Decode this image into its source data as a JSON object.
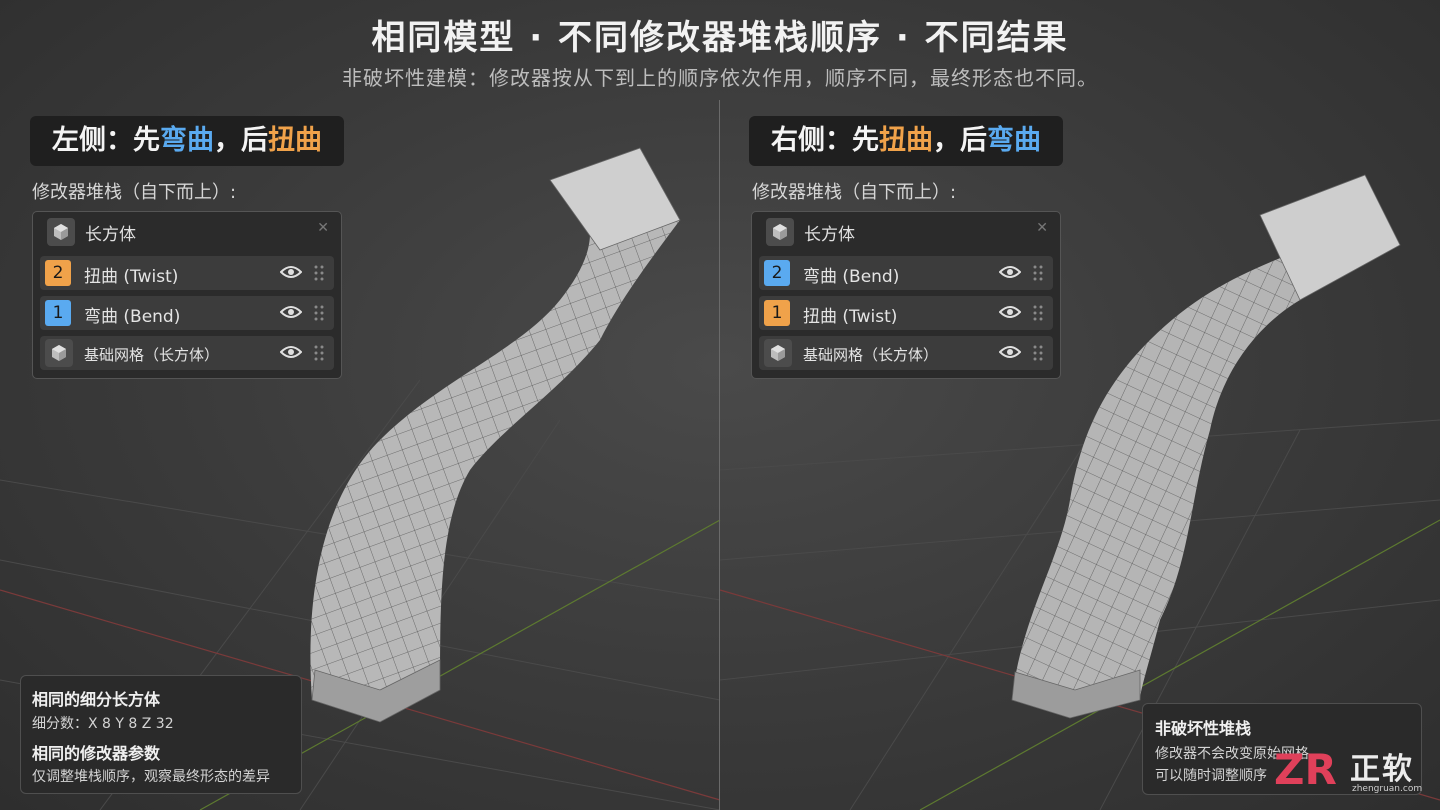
{
  "header": {
    "title": "相同模型 · 不同修改器堆栈顺序 · 不同结果",
    "subtitle": "非破坏性建模：修改器按从下到上的顺序依次作用，顺序不同，最终形态也不同。"
  },
  "left": {
    "title_parts": [
      "左侧：先",
      "弯曲",
      "，后",
      "扭曲"
    ],
    "stack_caption": "修改器堆栈（自下而上）:",
    "object_name": "长方体",
    "modifiers": [
      {
        "index": "2",
        "label": "扭曲 (Twist)",
        "color": "#f0a24a"
      },
      {
        "index": "1",
        "label": "弯曲 (Bend)",
        "color": "#5aaaf0"
      }
    ],
    "base_mesh": "基础网格（长方体）"
  },
  "right": {
    "title_parts": [
      "右侧：先",
      "扭曲",
      "，后",
      "弯曲"
    ],
    "stack_caption": "修改器堆栈（自下而上）:",
    "object_name": "长方体",
    "modifiers": [
      {
        "index": "2",
        "label": "弯曲 (Bend)",
        "color": "#5aaaf0"
      },
      {
        "index": "1",
        "label": "扭曲 (Twist)",
        "color": "#f0a24a"
      }
    ],
    "base_mesh": "基础网格（长方体）"
  },
  "info_left": {
    "heading1": "相同的细分长方体",
    "subdivisions": "细分数：X 8    Y 8    Z 32",
    "heading2": "相同的修改器参数",
    "note": "仅调整堆栈顺序，观察最终形态的差异"
  },
  "info_right": {
    "heading": "非破坏性堆栈",
    "line1": "修改器不会改变原始网格",
    "line2": "可以随时调整顺序"
  },
  "logo": {
    "mark": "ZR",
    "text": "正软",
    "url": "zhengruan.com"
  },
  "colors": {
    "accent_blue": "#5aaaf0",
    "accent_orange": "#f0a24a"
  },
  "icons": [
    "cube-icon",
    "eye-icon",
    "drag-handle-icon",
    "close-icon"
  ]
}
